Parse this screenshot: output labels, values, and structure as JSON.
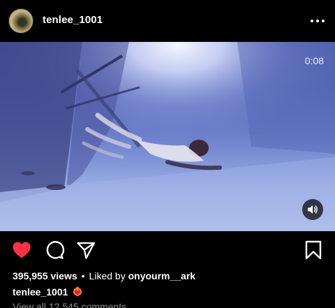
{
  "post": {
    "username": "tenlee_1001",
    "video_time": "0:08",
    "views": "395,955 views",
    "separator": "•",
    "liked_by_prefix": "Liked by",
    "liked_by_user": "onyourm__ark",
    "caption_user": "tenlee_1001",
    "caption_emoji": "heart-on-fire-emoji",
    "comments_link": "View all 12,545 comments",
    "liked": true
  },
  "colors": {
    "background": "#000000",
    "like_red": "#ff3040",
    "muted_text": "#8e8e8e"
  },
  "icons": [
    "more-icon",
    "volume-icon",
    "heart-icon",
    "comment-icon",
    "share-icon",
    "save-icon"
  ]
}
